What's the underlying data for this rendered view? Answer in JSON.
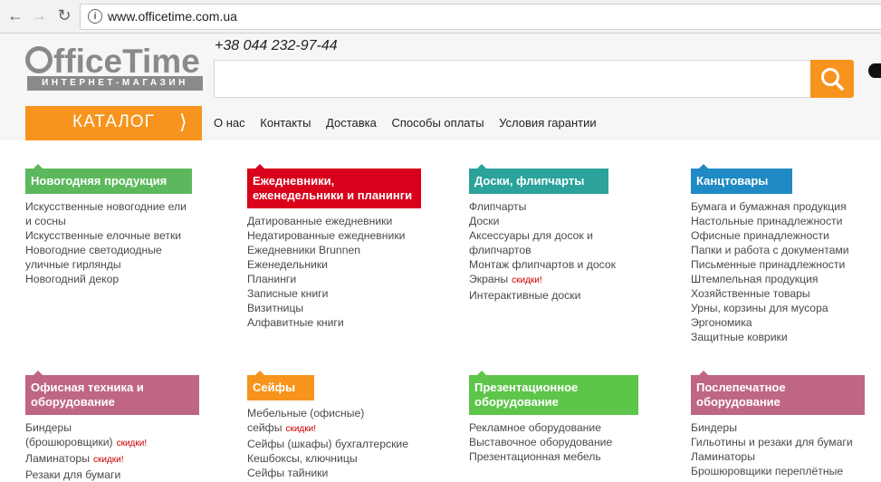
{
  "browser": {
    "url": "www.officetime.com.ua"
  },
  "header": {
    "logo_word": "fficeTime",
    "logo_sub": "ИНТЕРНЕТ-МАГАЗИН",
    "phone": "+38 044 232-97-44",
    "search_placeholder": "",
    "catalog_label": "КАТАЛОГ",
    "menu": [
      "О нас",
      "Контакты",
      "Доставка",
      "Способы оплаты",
      "Условия гарантии"
    ]
  },
  "colors": {
    "orange": "#f7941d",
    "green": "#5cb85c",
    "red": "#d9001b",
    "teal": "#2ba39b",
    "blue": "#1f8ac4",
    "mauve": "#bf6683",
    "lime": "#5ec54b"
  },
  "categories": [
    {
      "title": "Новогодняя продукция",
      "color": "#5cb85c",
      "links": [
        [
          "Искусственные новогодние ели",
          ""
        ],
        [
          "и сосны",
          ""
        ],
        [
          "Искусственные елочные ветки",
          ""
        ],
        [
          "Новогодние светодиодные",
          ""
        ],
        [
          "уличные гирлянды",
          ""
        ],
        [
          "Новогодний декор",
          ""
        ]
      ]
    },
    {
      "title": "Ежедневники, еженедельники и планинги",
      "color": "#d9001b",
      "links": [
        [
          "Датированные ежедневники",
          ""
        ],
        [
          "Недатированные ежедневники",
          ""
        ],
        [
          "Ежедневники Brunnen",
          ""
        ],
        [
          "Еженедельники",
          ""
        ],
        [
          "Планинги",
          ""
        ],
        [
          "Записные книги",
          ""
        ],
        [
          "Визитницы",
          ""
        ],
        [
          "Алфавитные книги",
          ""
        ]
      ]
    },
    {
      "title": "Доски, флипчарты",
      "color": "#2ba39b",
      "links": [
        [
          "Флипчарты",
          ""
        ],
        [
          "Доски",
          ""
        ],
        [
          "Аксессуары для досок и",
          ""
        ],
        [
          "флипчартов",
          ""
        ],
        [
          "Монтаж флипчартов и досок",
          ""
        ],
        [
          "Экраны",
          "скидки!"
        ],
        [
          "Интерактивные доски",
          ""
        ]
      ]
    },
    {
      "title": "Канцтовары",
      "color": "#1f8ac4",
      "links": [
        [
          "Бумага и бумажная продукция",
          ""
        ],
        [
          "Настольные принадлежности",
          ""
        ],
        [
          "Офисные принадлежности",
          ""
        ],
        [
          "Папки и работа с документами",
          ""
        ],
        [
          "Письменные принадлежности",
          ""
        ],
        [
          "Штемпельная продукция",
          ""
        ],
        [
          "Хозяйственные товары",
          ""
        ],
        [
          "Урны, корзины для мусора",
          ""
        ],
        [
          "Эргономика",
          ""
        ],
        [
          "Защитные коврики",
          ""
        ]
      ]
    },
    {
      "title": "Офисная техника и оборудование",
      "color": "#bf6683",
      "links": [
        [
          "Биндеры",
          ""
        ],
        [
          "(брошюровщики)",
          "скидки!"
        ],
        [
          "Ламинаторы",
          "скидки!"
        ],
        [
          "Резаки для бумаги",
          ""
        ]
      ]
    },
    {
      "title": "Сейфы",
      "color": "#f7941d",
      "links": [
        [
          "Мебельные (офисные)",
          ""
        ],
        [
          "сейфы",
          "скидки!"
        ],
        [
          "Сейфы (шкафы) бухгалтерские",
          ""
        ],
        [
          "Кешбоксы, ключницы",
          ""
        ],
        [
          "Сейфы тайники",
          ""
        ]
      ]
    },
    {
      "title": "Презентационное оборудование",
      "color": "#5ec54b",
      "links": [
        [
          "Рекламное оборудование",
          ""
        ],
        [
          "Выставочное оборудование",
          ""
        ],
        [
          "Презентационная мебель",
          ""
        ]
      ]
    },
    {
      "title": "Послепечатное оборудование",
      "color": "#bf6683",
      "links": [
        [
          "Биндеры",
          ""
        ],
        [
          "Гильотины и резаки для бумаги",
          ""
        ],
        [
          "Ламинаторы",
          ""
        ],
        [
          "Брошюровщики переплётные",
          ""
        ]
      ]
    }
  ]
}
